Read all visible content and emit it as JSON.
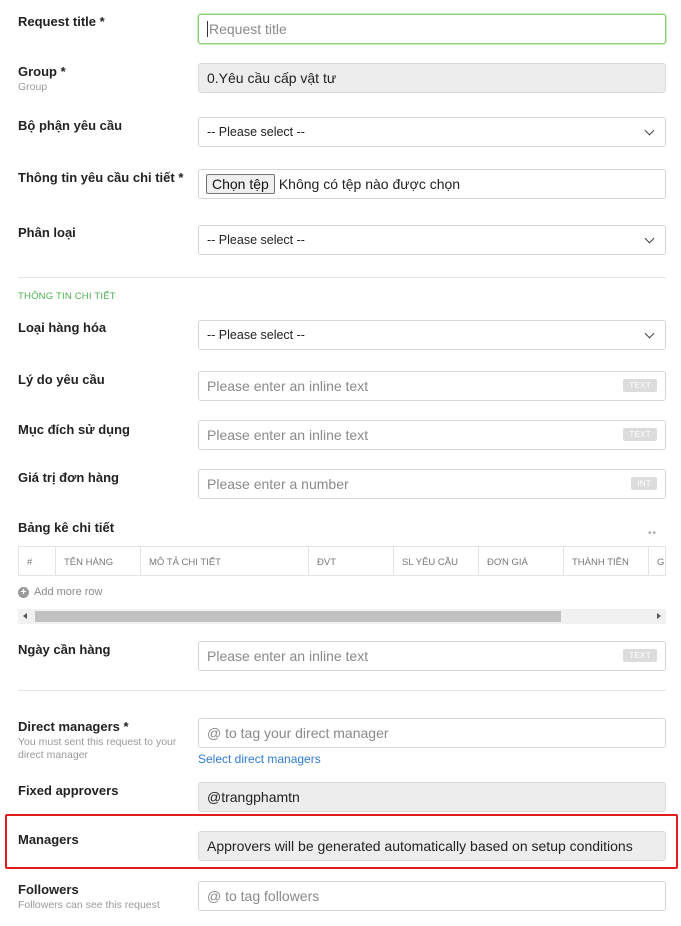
{
  "request_title": {
    "label": "Request title *",
    "placeholder": "Request title"
  },
  "group": {
    "label": "Group *",
    "sublabel": "Group",
    "value": "0.Yêu cầu cấp vật tư"
  },
  "bo_phan": {
    "label": "Bộ phận yêu cầu",
    "value": "-- Please select --"
  },
  "thong_tin": {
    "label": "Thông tin yêu cầu chi tiết *",
    "button": "Chọn tệp",
    "status": "Không có tệp nào được chọn"
  },
  "phan_loai": {
    "label": "Phân loại",
    "value": "-- Please select --"
  },
  "section_title": "THÔNG TIN CHI TIẾT",
  "loai_hang": {
    "label": "Loại hàng hóa",
    "value": "-- Please select --"
  },
  "ly_do": {
    "label": "Lý do yêu cầu",
    "placeholder": "Please enter an inline text",
    "badge": "TEXT"
  },
  "muc_dich": {
    "label": "Mục đích sử dụng",
    "placeholder": "Please enter an inline text",
    "badge": "TEXT"
  },
  "gia_tri": {
    "label": "Giá trị đơn hàng",
    "placeholder": "Please enter a number",
    "badge": "INT"
  },
  "bang_ke": {
    "label": "Bảng kê chi tiết",
    "columns": [
      "#",
      "TÊN HÀNG",
      "MÔ TẢ CHI TIẾT",
      "ĐVT",
      "SL YÊU CẦU",
      "ĐƠN GIÁ",
      "THÀNH TIỀN",
      "GH"
    ],
    "add_row": "Add more row"
  },
  "ngay_can": {
    "label": "Ngày cần hàng",
    "placeholder": "Please enter an inline text",
    "badge": "TEXT"
  },
  "direct_managers": {
    "label": "Direct managers *",
    "sublabel": "You must sent this request to your direct manager",
    "placeholder": "@ to tag your direct manager",
    "link": "Select direct managers"
  },
  "fixed_approvers": {
    "label": "Fixed approvers",
    "value": "@trangphamtn"
  },
  "managers": {
    "label": "Managers",
    "value": "Approvers will be generated automatically based on setup conditions"
  },
  "followers": {
    "label": "Followers",
    "sublabel": "Followers can see this request",
    "placeholder": "@ to tag followers"
  },
  "colors": {
    "accent_green": "#4caf50",
    "link_blue": "#2f7bd0",
    "highlight_red": "#e01b1b"
  }
}
